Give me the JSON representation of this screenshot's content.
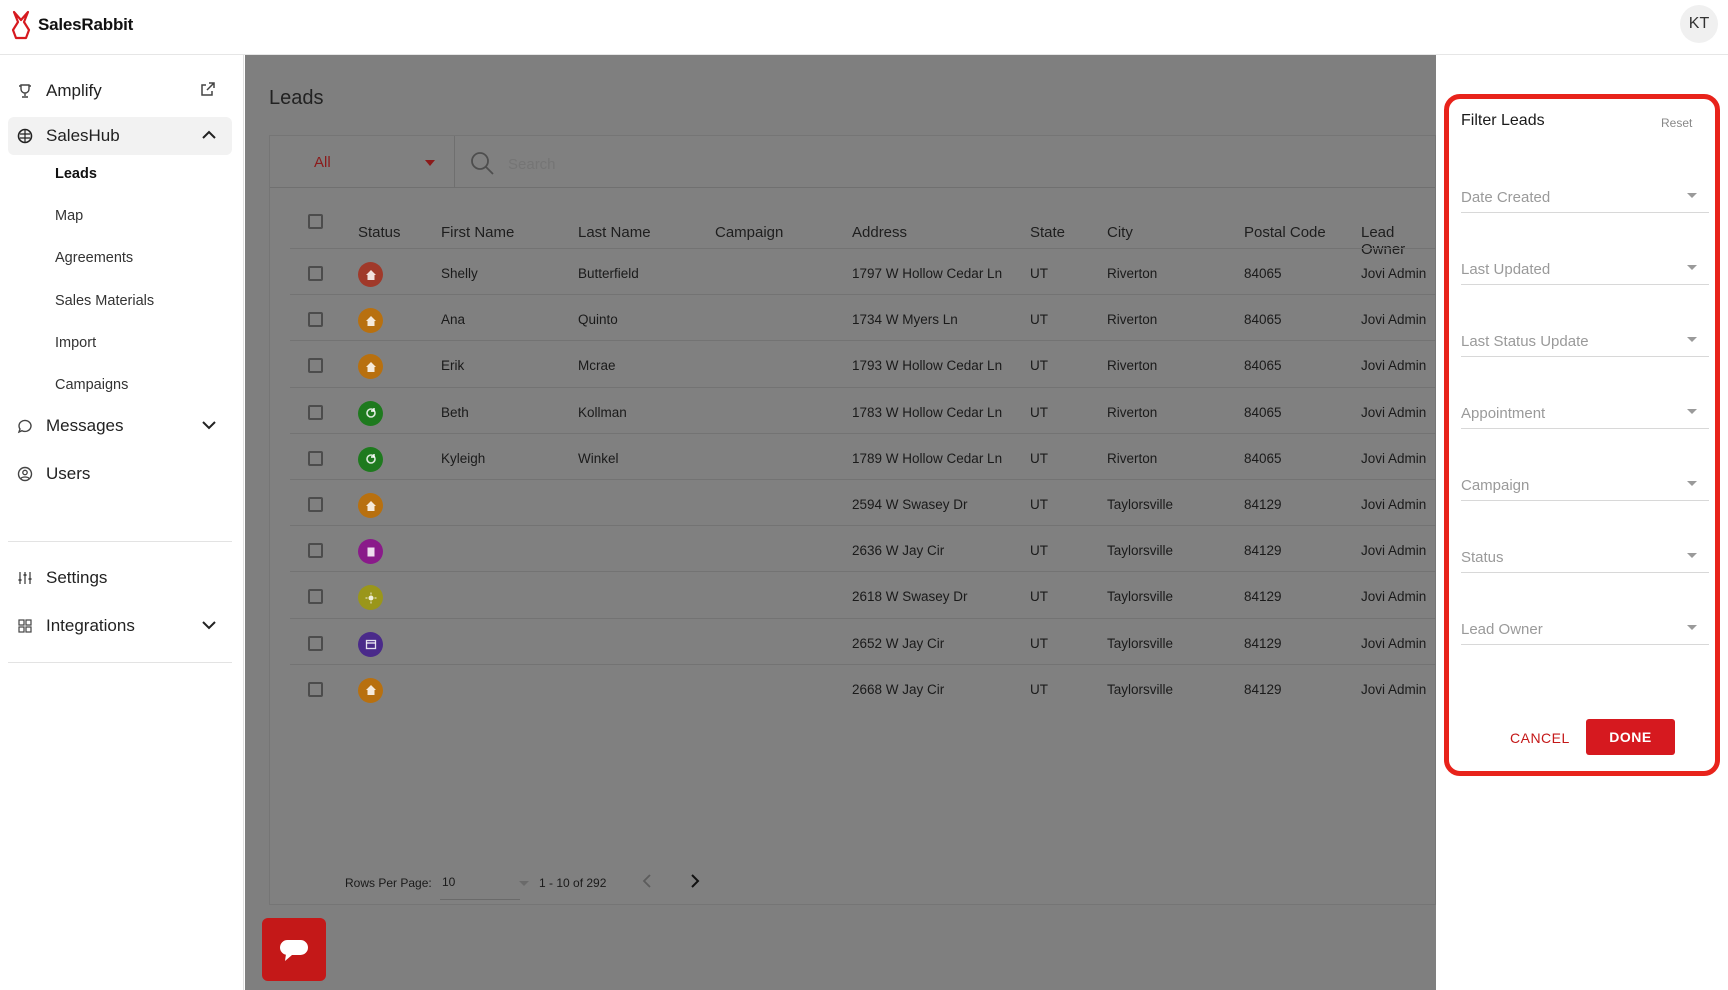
{
  "app": {
    "name": "SalesRabbit",
    "user_initials": "KT"
  },
  "sidebar": {
    "items": [
      {
        "label": "Amplify"
      },
      {
        "label": "SalesHub"
      },
      {
        "label": "Messages"
      },
      {
        "label": "Users"
      },
      {
        "label": "Settings"
      },
      {
        "label": "Integrations"
      }
    ],
    "saleshub_sub": [
      "Leads",
      "Map",
      "Agreements",
      "Sales Materials",
      "Import",
      "Campaigns"
    ]
  },
  "main": {
    "title": "Leads",
    "filter_select": "All",
    "search_placeholder": "Search",
    "columns": [
      "Status",
      "First Name",
      "Last Name",
      "Campaign",
      "Address",
      "State",
      "City",
      "Postal Code",
      "Lead Owner"
    ],
    "rows": [
      {
        "status": "home-dark",
        "status_color": "#a0392a",
        "first": "Shelly",
        "last": "Butterfield",
        "campaign": "",
        "address": "1797 W Hollow Cedar Ln",
        "state": "UT",
        "city": "Riverton",
        "postal": "84065",
        "owner": "Jovi Admin"
      },
      {
        "status": "home",
        "status_color": "#b8700f",
        "first": "Ana",
        "last": "Quinto",
        "campaign": "",
        "address": "1734 W Myers Ln",
        "state": "UT",
        "city": "Riverton",
        "postal": "84065",
        "owner": "Jovi Admin"
      },
      {
        "status": "home",
        "status_color": "#b8700f",
        "first": "Erik",
        "last": "Mcrae",
        "campaign": "",
        "address": "1793 W Hollow Cedar Ln",
        "state": "UT",
        "city": "Riverton",
        "postal": "84065",
        "owner": "Jovi Admin"
      },
      {
        "status": "refresh",
        "status_color": "#1e7a1e",
        "first": "Beth",
        "last": "Kollman",
        "campaign": "",
        "address": "1783 W Hollow Cedar Ln",
        "state": "UT",
        "city": "Riverton",
        "postal": "84065",
        "owner": "Jovi Admin"
      },
      {
        "status": "refresh",
        "status_color": "#1e7a1e",
        "first": "Kyleigh",
        "last": "Winkel",
        "campaign": "",
        "address": "1789 W Hollow Cedar Ln",
        "state": "UT",
        "city": "Riverton",
        "postal": "84065",
        "owner": "Jovi Admin"
      },
      {
        "status": "home",
        "status_color": "#b8700f",
        "first": "",
        "last": "",
        "campaign": "",
        "address": "2594 W Swasey Dr",
        "state": "UT",
        "city": "Taylorsville",
        "postal": "84129",
        "owner": "Jovi Admin"
      },
      {
        "status": "document",
        "status_color": "#8a1a8a",
        "first": "",
        "last": "",
        "campaign": "",
        "address": "2636 W Jay Cir",
        "state": "UT",
        "city": "Taylorsville",
        "postal": "84129",
        "owner": "Jovi Admin"
      },
      {
        "status": "sun",
        "status_color": "#9a961a",
        "first": "",
        "last": "",
        "campaign": "",
        "address": "2618 W Swasey Dr",
        "state": "UT",
        "city": "Taylorsville",
        "postal": "84129",
        "owner": "Jovi Admin"
      },
      {
        "status": "calendar",
        "status_color": "#4a2a8a",
        "first": "",
        "last": "",
        "campaign": "",
        "address": "2652 W Jay Cir",
        "state": "UT",
        "city": "Taylorsville",
        "postal": "84129",
        "owner": "Jovi Admin"
      },
      {
        "status": "home",
        "status_color": "#b8700f",
        "first": "",
        "last": "",
        "campaign": "",
        "address": "2668 W Jay Cir",
        "state": "UT",
        "city": "Taylorsville",
        "postal": "84129",
        "owner": "Jovi Admin"
      }
    ],
    "pagination": {
      "rows_per_page_label": "Rows Per Page:",
      "rows_per_page": "10",
      "range": "1 - 10 of 292"
    }
  },
  "filter_panel": {
    "title": "Filter Leads",
    "reset": "Reset",
    "fields": [
      "Date Created",
      "Last Updated",
      "Last Status Update",
      "Appointment",
      "Campaign",
      "Status",
      "Lead Owner"
    ],
    "cancel": "CANCEL",
    "done": "DONE",
    "highlight_color": "#e8231b"
  }
}
